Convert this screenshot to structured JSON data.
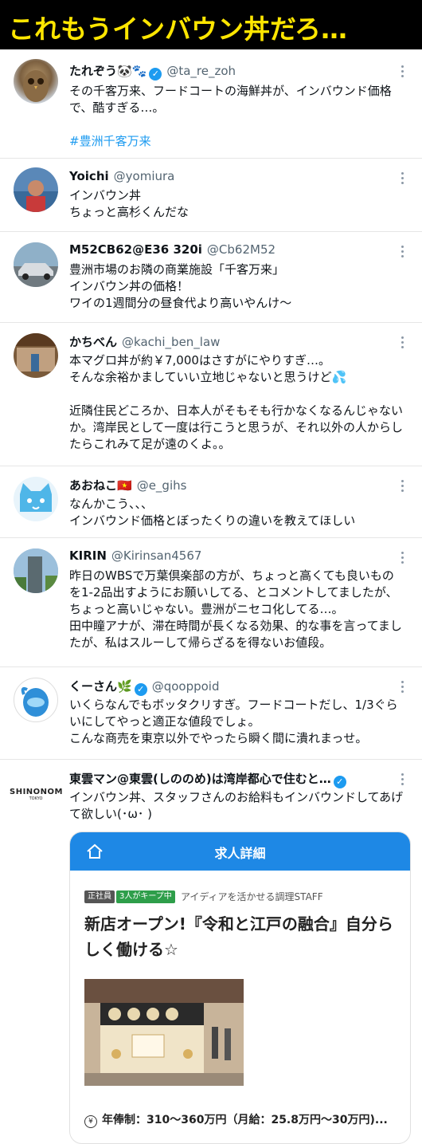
{
  "banner": {
    "title": "これもうインバウン丼だろ…"
  },
  "tweets": [
    {
      "name": "たれぞう🐼🐾",
      "handle": "@ta_re_zoh",
      "verified": true,
      "lines": [
        "その千客万来、フードコートの海鮮丼が、インバウンド価格",
        "で、酷すぎる…。"
      ],
      "hashtag": "#豊洲千客万来"
    },
    {
      "name": "Yoichi",
      "handle": "@yomiura",
      "lines": [
        "インバウン丼",
        "ちょっと高杉くんだな"
      ]
    },
    {
      "name": "M52CB62@E36 320i",
      "handle": "@Cb62M52",
      "lines": [
        "豊洲市場のお隣の商業施設「千客万来」",
        "インバウン丼の価格！",
        "ワイの1週間分の昼食代より高いやんけ〜"
      ]
    },
    {
      "name": "かちべん",
      "handle": "@kachi_ben_law",
      "lines": [
        "本マグロ丼が約￥7,000はさすがにやりすぎ…。",
        "そんな余裕かましていい立地じゃないと思うけど💦",
        "",
        "近隣住民どころか、日本人がそもそも行かなくなるんじゃない",
        "か。湾岸民として一度は行こうと思うが、それ以外の人からし",
        "たらこれみて足が遠のくよ。。"
      ]
    },
    {
      "name": "あおねこ🇻🇳",
      "handle": "@e_gihs",
      "lines": [
        "なんかこう、、、",
        "インバウンド価格とぼったくりの違いを教えてほしい"
      ]
    },
    {
      "name": "KIRIN",
      "handle": "@Kirinsan4567",
      "lines": [
        "昨日のWBSで万葉倶楽部の方が、ちょっと高くても良いもの",
        "を1-2品出すようにお願いしてる、とコメントしてましたが、",
        "ちょっと高いじゃない。豊洲がニセコ化してる…。",
        "田中瞳アナが、滞在時間が長くなる効果、的な事を言ってまし",
        "たが、私はスルーして帰らざるを得ないお値段。"
      ]
    },
    {
      "name": "くーさん🌿",
      "handle": "@qooppoid",
      "verified": true,
      "lines": [
        "いくらなんでもボッタクリすぎ。フードコートだし、1/3ぐら",
        "いにしてやっと適正な値段でしょ。",
        "こんな商売を東京以外でやったら瞬く間に潰れまっせ。"
      ]
    },
    {
      "name": "東雲マン@東雲(しののめ)は湾岸都心で住むと…",
      "handle": "",
      "verified": true,
      "logo_text": "SHINONOME",
      "logo_sub": "TOKYO",
      "lines": [
        "インバウン丼、スタッフさんのお給料もインバウンドしてあげ",
        "て欲しい(･ω･ )"
      ]
    }
  ],
  "job_card": {
    "header": "求人詳細",
    "badge_type": "正社員",
    "badge_keep": "3人がキープ中",
    "subtitle": "アイディアを活かせる調理STAFF",
    "title_lines": [
      "新店オープン!『令和と江戸の融合』自分ら",
      "しく働ける☆"
    ],
    "salary": "年俸制：310〜360万円（月給：25.8万円〜30万円)..."
  },
  "colors": {
    "banner_bg": "#000000",
    "banner_text": "#ffe600",
    "link": "#1d9bf0",
    "job_header": "#1e88e5"
  }
}
